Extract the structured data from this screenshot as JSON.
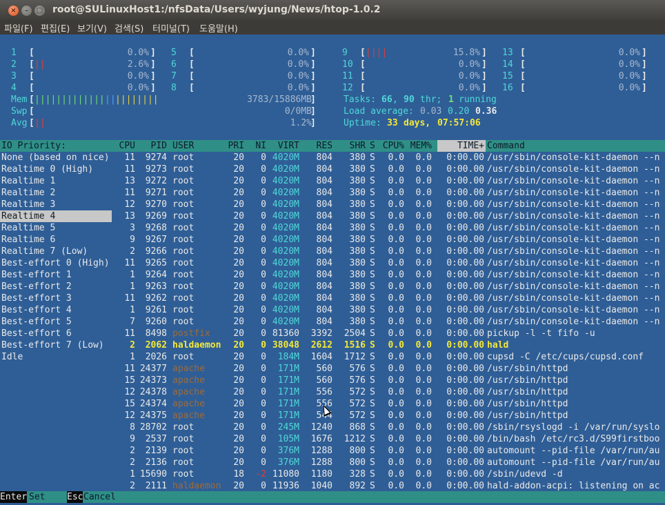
{
  "window": {
    "title": "root@SULinuxHost1:/nfsData/Users/wyjung/News/htop-1.0.2",
    "close_glyph": "×",
    "min_glyph": "–",
    "max_glyph": "□"
  },
  "menubar": [
    {
      "label": "파일(F)"
    },
    {
      "label": "편집(E)"
    },
    {
      "label": "보기(V)"
    },
    {
      "label": "검색(S)"
    },
    {
      "label": "터미널(T)"
    },
    {
      "label": "도움말(H)"
    }
  ],
  "cpu_meters": [
    {
      "id": "1",
      "bar": "",
      "pct": "0.0%"
    },
    {
      "id": "2",
      "bar": "||",
      "pct": "2.6%"
    },
    {
      "id": "3",
      "bar": "",
      "pct": "0.0%"
    },
    {
      "id": "4",
      "bar": "",
      "pct": "0.0%"
    },
    {
      "id": "5",
      "bar": "",
      "pct": "0.0%"
    },
    {
      "id": "6",
      "bar": "",
      "pct": "0.0%"
    },
    {
      "id": "7",
      "bar": "",
      "pct": "0.0%"
    },
    {
      "id": "8",
      "bar": "",
      "pct": "0.0%"
    },
    {
      "id": "9",
      "bar": "||||",
      "pct": "15.8%"
    },
    {
      "id": "10",
      "bar": "",
      "pct": "0.0%"
    },
    {
      "id": "11",
      "bar": "",
      "pct": "0.0%"
    },
    {
      "id": "12",
      "bar": "",
      "pct": "0.0%"
    },
    {
      "id": "13",
      "bar": "",
      "pct": "0.0%"
    },
    {
      "id": "14",
      "bar": "",
      "pct": "0.0%"
    },
    {
      "id": "15",
      "bar": "",
      "pct": "0.0%"
    },
    {
      "id": "16",
      "bar": "",
      "pct": "0.0%"
    }
  ],
  "mem": {
    "label": "Mem",
    "bar_g": "|||||||||||||",
    "bar_b": "||",
    "bar_y": "||||||||",
    "value": "3783/15886MB"
  },
  "swp": {
    "label": "Swp",
    "value": "0/0MB"
  },
  "avg": {
    "label": "Avg",
    "bar": "||",
    "value": "1.2%"
  },
  "tasks": {
    "label": "Tasks:",
    "count": "66",
    "sep": ",",
    "thr": "90",
    "thr_label": "thr;",
    "running": "1",
    "running_label": "running"
  },
  "load": {
    "label": "Load average:",
    "v1": "0.03",
    "v2": "0.20",
    "v3": "0.36"
  },
  "uptime": {
    "label": "Uptime:",
    "days": "33",
    "days_label": "days,",
    "time": "07:57:06"
  },
  "io_panel": {
    "header": "IO Priority:",
    "selected_index": 5,
    "items": [
      {
        "label": "None (based on nice)"
      },
      {
        "label": "Realtime 0 (High)"
      },
      {
        "label": "Realtime 1"
      },
      {
        "label": "Realtime 2"
      },
      {
        "label": "Realtime 3"
      },
      {
        "label": "Realtime 4"
      },
      {
        "label": "Realtime 5"
      },
      {
        "label": "Realtime 6"
      },
      {
        "label": "Realtime 7 (Low)"
      },
      {
        "label": "Best-effort 0 (High)"
      },
      {
        "label": "Best-effort 1"
      },
      {
        "label": "Best-effort 2"
      },
      {
        "label": "Best-effort 3"
      },
      {
        "label": "Best-effort 4"
      },
      {
        "label": "Best-effort 5"
      },
      {
        "label": "Best-effort 6"
      },
      {
        "label": "Best-effort 7 (Low)"
      },
      {
        "label": "Idle"
      }
    ]
  },
  "columns": [
    "CPU",
    "PID",
    "USER",
    "PRI",
    "NI",
    "VIRT",
    "RES",
    "SHR",
    "S",
    "CPU%",
    "MEM%",
    "TIME+",
    "Command"
  ],
  "sort_column": "TIME+",
  "processes": [
    {
      "cpu": "11",
      "pid": "9274",
      "user": "root",
      "pri": "20",
      "ni": "0",
      "virt": "4020M",
      "res": "804",
      "shr": "380",
      "s": "S",
      "cpup": "0.0",
      "memp": "0.0",
      "time": "0:00.00",
      "cmd": "/usr/sbin/console-kit-daemon --n"
    },
    {
      "cpu": "11",
      "pid": "9273",
      "user": "root",
      "pri": "20",
      "ni": "0",
      "virt": "4020M",
      "res": "804",
      "shr": "380",
      "s": "S",
      "cpup": "0.0",
      "memp": "0.0",
      "time": "0:00.00",
      "cmd": "/usr/sbin/console-kit-daemon --n"
    },
    {
      "cpu": "13",
      "pid": "9272",
      "user": "root",
      "pri": "20",
      "ni": "0",
      "virt": "4020M",
      "res": "804",
      "shr": "380",
      "s": "S",
      "cpup": "0.0",
      "memp": "0.0",
      "time": "0:00.00",
      "cmd": "/usr/sbin/console-kit-daemon --n"
    },
    {
      "cpu": "11",
      "pid": "9271",
      "user": "root",
      "pri": "20",
      "ni": "0",
      "virt": "4020M",
      "res": "804",
      "shr": "380",
      "s": "S",
      "cpup": "0.0",
      "memp": "0.0",
      "time": "0:00.00",
      "cmd": "/usr/sbin/console-kit-daemon --n"
    },
    {
      "cpu": "12",
      "pid": "9270",
      "user": "root",
      "pri": "20",
      "ni": "0",
      "virt": "4020M",
      "res": "804",
      "shr": "380",
      "s": "S",
      "cpup": "0.0",
      "memp": "0.0",
      "time": "0:00.00",
      "cmd": "/usr/sbin/console-kit-daemon --n"
    },
    {
      "cpu": "13",
      "pid": "9269",
      "user": "root",
      "pri": "20",
      "ni": "0",
      "virt": "4020M",
      "res": "804",
      "shr": "380",
      "s": "S",
      "cpup": "0.0",
      "memp": "0.0",
      "time": "0:00.00",
      "cmd": "/usr/sbin/console-kit-daemon --n"
    },
    {
      "cpu": "3",
      "pid": "9268",
      "user": "root",
      "pri": "20",
      "ni": "0",
      "virt": "4020M",
      "res": "804",
      "shr": "380",
      "s": "S",
      "cpup": "0.0",
      "memp": "0.0",
      "time": "0:00.00",
      "cmd": "/usr/sbin/console-kit-daemon --n"
    },
    {
      "cpu": "9",
      "pid": "9267",
      "user": "root",
      "pri": "20",
      "ni": "0",
      "virt": "4020M",
      "res": "804",
      "shr": "380",
      "s": "S",
      "cpup": "0.0",
      "memp": "0.0",
      "time": "0:00.00",
      "cmd": "/usr/sbin/console-kit-daemon --n"
    },
    {
      "cpu": "2",
      "pid": "9266",
      "user": "root",
      "pri": "20",
      "ni": "0",
      "virt": "4020M",
      "res": "804",
      "shr": "380",
      "s": "S",
      "cpup": "0.0",
      "memp": "0.0",
      "time": "0:00.00",
      "cmd": "/usr/sbin/console-kit-daemon --n"
    },
    {
      "cpu": "11",
      "pid": "9265",
      "user": "root",
      "pri": "20",
      "ni": "0",
      "virt": "4020M",
      "res": "804",
      "shr": "380",
      "s": "S",
      "cpup": "0.0",
      "memp": "0.0",
      "time": "0:00.00",
      "cmd": "/usr/sbin/console-kit-daemon --n"
    },
    {
      "cpu": "1",
      "pid": "9264",
      "user": "root",
      "pri": "20",
      "ni": "0",
      "virt": "4020M",
      "res": "804",
      "shr": "380",
      "s": "S",
      "cpup": "0.0",
      "memp": "0.0",
      "time": "0:00.00",
      "cmd": "/usr/sbin/console-kit-daemon --n"
    },
    {
      "cpu": "1",
      "pid": "9263",
      "user": "root",
      "pri": "20",
      "ni": "0",
      "virt": "4020M",
      "res": "804",
      "shr": "380",
      "s": "S",
      "cpup": "0.0",
      "memp": "0.0",
      "time": "0:00.00",
      "cmd": "/usr/sbin/console-kit-daemon --n"
    },
    {
      "cpu": "11",
      "pid": "9262",
      "user": "root",
      "pri": "20",
      "ni": "0",
      "virt": "4020M",
      "res": "804",
      "shr": "380",
      "s": "S",
      "cpup": "0.0",
      "memp": "0.0",
      "time": "0:00.00",
      "cmd": "/usr/sbin/console-kit-daemon --n"
    },
    {
      "cpu": "1",
      "pid": "9261",
      "user": "root",
      "pri": "20",
      "ni": "0",
      "virt": "4020M",
      "res": "804",
      "shr": "380",
      "s": "S",
      "cpup": "0.0",
      "memp": "0.0",
      "time": "0:00.00",
      "cmd": "/usr/sbin/console-kit-daemon --n"
    },
    {
      "cpu": "7",
      "pid": "9260",
      "user": "root",
      "pri": "20",
      "ni": "0",
      "virt": "4020M",
      "res": "804",
      "shr": "380",
      "s": "S",
      "cpup": "0.0",
      "memp": "0.0",
      "time": "0:00.00",
      "cmd": "/usr/sbin/console-kit-daemon --n"
    },
    {
      "cpu": "11",
      "pid": "8498",
      "user": "postfix",
      "pri": "20",
      "ni": "0",
      "virt": "81360",
      "res": "3392",
      "shr": "2504",
      "s": "S",
      "cpup": "0.0",
      "memp": "0.0",
      "time": "0:00.00",
      "cmd": "pickup -l -t fifo -u"
    },
    {
      "cpu": "2",
      "pid": "2062",
      "user": "haldaemon",
      "pri": "20",
      "ni": "0",
      "virt": "38048",
      "res": "2612",
      "shr": "1516",
      "s": "S",
      "cpup": "0.0",
      "memp": "0.0",
      "time": "0:00.00",
      "cmd": "hald",
      "highlight": true
    },
    {
      "cpu": "1",
      "pid": "2026",
      "user": "root",
      "pri": "20",
      "ni": "0",
      "virt": "184M",
      "res": "1604",
      "shr": "1712",
      "s": "S",
      "cpup": "0.0",
      "memp": "0.0",
      "time": "0:00.00",
      "cmd": "cupsd -C /etc/cups/cupsd.conf"
    },
    {
      "cpu": "11",
      "pid": "24377",
      "user": "apache",
      "pri": "20",
      "ni": "0",
      "virt": "171M",
      "res": "560",
      "shr": "576",
      "s": "S",
      "cpup": "0.0",
      "memp": "0.0",
      "time": "0:00.00",
      "cmd": "/usr/sbin/httpd"
    },
    {
      "cpu": "15",
      "pid": "24373",
      "user": "apache",
      "pri": "20",
      "ni": "0",
      "virt": "171M",
      "res": "560",
      "shr": "576",
      "s": "S",
      "cpup": "0.0",
      "memp": "0.0",
      "time": "0:00.00",
      "cmd": "/usr/sbin/httpd"
    },
    {
      "cpu": "12",
      "pid": "24378",
      "user": "apache",
      "pri": "20",
      "ni": "0",
      "virt": "171M",
      "res": "556",
      "shr": "572",
      "s": "S",
      "cpup": "0.0",
      "memp": "0.0",
      "time": "0:00.00",
      "cmd": "/usr/sbin/httpd"
    },
    {
      "cpu": "15",
      "pid": "24374",
      "user": "apache",
      "pri": "20",
      "ni": "0",
      "virt": "171M",
      "res": "556",
      "shr": "572",
      "s": "S",
      "cpup": "0.0",
      "memp": "0.0",
      "time": "0:00.00",
      "cmd": "/usr/sbin/httpd"
    },
    {
      "cpu": "12",
      "pid": "24375",
      "user": "apache",
      "pri": "20",
      "ni": "0",
      "virt": "171M",
      "res": "544",
      "shr": "572",
      "s": "S",
      "cpup": "0.0",
      "memp": "0.0",
      "time": "0:00.00",
      "cmd": "/usr/sbin/httpd"
    },
    {
      "cpu": "8",
      "pid": "28702",
      "user": "root",
      "pri": "20",
      "ni": "0",
      "virt": "245M",
      "res": "1240",
      "shr": "868",
      "s": "S",
      "cpup": "0.0",
      "memp": "0.0",
      "time": "0:00.00",
      "cmd": "/sbin/rsyslogd -i /var/run/syslo"
    },
    {
      "cpu": "9",
      "pid": "2537",
      "user": "root",
      "pri": "20",
      "ni": "0",
      "virt": "105M",
      "res": "1676",
      "shr": "1212",
      "s": "S",
      "cpup": "0.0",
      "memp": "0.0",
      "time": "0:00.00",
      "cmd": "/bin/bash /etc/rc3.d/S99firstboo"
    },
    {
      "cpu": "2",
      "pid": "2139",
      "user": "root",
      "pri": "20",
      "ni": "0",
      "virt": "376M",
      "res": "1288",
      "shr": "800",
      "s": "S",
      "cpup": "0.0",
      "memp": "0.0",
      "time": "0:00.00",
      "cmd": "automount --pid-file /var/run/au"
    },
    {
      "cpu": "2",
      "pid": "2136",
      "user": "root",
      "pri": "20",
      "ni": "0",
      "virt": "376M",
      "res": "1288",
      "shr": "800",
      "s": "S",
      "cpup": "0.0",
      "memp": "0.0",
      "time": "0:00.00",
      "cmd": "automount --pid-file /var/run/au"
    },
    {
      "cpu": "1",
      "pid": "15690",
      "user": "root",
      "pri": "18",
      "ni": "-2",
      "virt": "11080",
      "res": "1180",
      "shr": "328",
      "s": "S",
      "cpup": "0.0",
      "memp": "0.0",
      "time": "0:00.00",
      "cmd": "/sbin/udevd -d"
    },
    {
      "cpu": "2",
      "pid": "2111",
      "user": "haldaemon",
      "pri": "20",
      "ni": "0",
      "virt": "11936",
      "res": "1040",
      "shr": "892",
      "s": "S",
      "cpup": "0.0",
      "memp": "0.0",
      "time": "0:00.00",
      "cmd": "hald-addon-acpi: listening on ac"
    }
  ],
  "footer": [
    {
      "key": "Enter",
      "label": "Set"
    },
    {
      "key": "Esc",
      "label": "Cancel"
    }
  ]
}
